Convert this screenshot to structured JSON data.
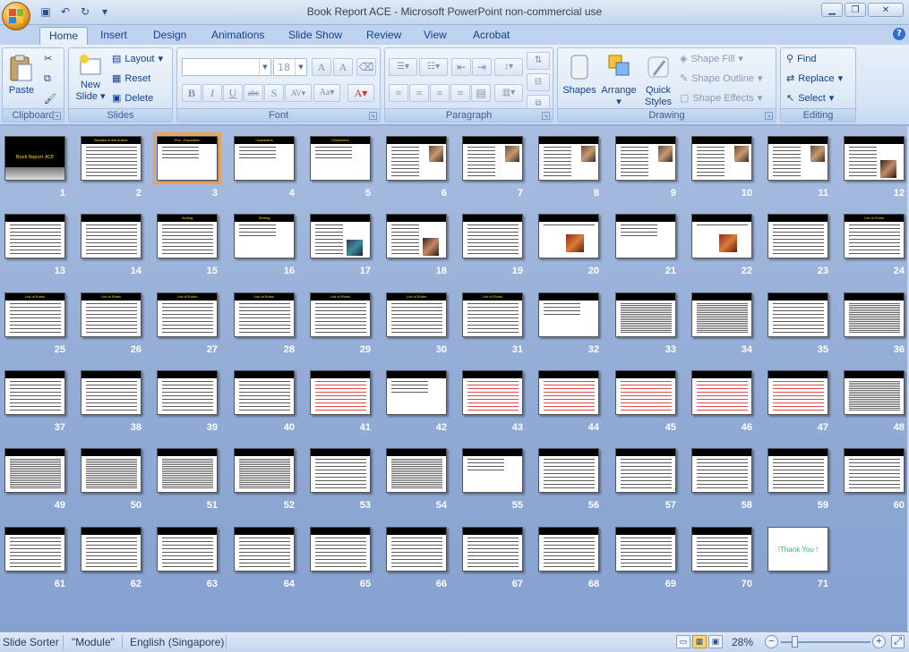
{
  "window": {
    "title": "Book Report ACE - Microsoft PowerPoint non-commercial use"
  },
  "tabs": [
    "Home",
    "Insert",
    "Design",
    "Animations",
    "Slide Show",
    "Review",
    "View",
    "Acrobat"
  ],
  "ribbon": {
    "clipboard": {
      "label": "Clipboard",
      "paste": "Paste"
    },
    "slides": {
      "label": "Slides",
      "new_slide": "New",
      "new_slide_2": "Slide",
      "layout": "Layout",
      "reset": "Reset",
      "delete": "Delete"
    },
    "font": {
      "label": "Font",
      "font_size": "18"
    },
    "paragraph": {
      "label": "Paragraph"
    },
    "drawing": {
      "label": "Drawing",
      "shapes": "Shapes",
      "arrange": "Arrange",
      "quick_styles_1": "Quick",
      "quick_styles_2": "Styles",
      "shape_fill": "Shape Fill",
      "shape_outline": "Shape Outline",
      "shape_effects": "Shape Effects"
    },
    "editing": {
      "label": "Editing",
      "find": "Find",
      "replace": "Replace",
      "select": "Select"
    }
  },
  "slides": [
    {
      "n": "1",
      "title": "Book Report ACE",
      "kind": "cover"
    },
    {
      "n": "2",
      "title": "Biodata of the Author",
      "kind": "text"
    },
    {
      "n": "3",
      "title": "Plot - Exposition",
      "kind": "short",
      "selected": true
    },
    {
      "n": "4",
      "title": "Characters",
      "kind": "short"
    },
    {
      "n": "5",
      "title": "Characters",
      "kind": "short"
    },
    {
      "n": "6",
      "title": "",
      "kind": "photo"
    },
    {
      "n": "7",
      "title": "",
      "kind": "photo"
    },
    {
      "n": "8",
      "title": "",
      "kind": "photo"
    },
    {
      "n": "9",
      "title": "",
      "kind": "photo"
    },
    {
      "n": "10",
      "title": "",
      "kind": "photo"
    },
    {
      "n": "11",
      "title": "",
      "kind": "photo"
    },
    {
      "n": "12",
      "title": "",
      "kind": "face"
    },
    {
      "n": "13",
      "title": "",
      "kind": "text"
    },
    {
      "n": "14",
      "title": "",
      "kind": "text"
    },
    {
      "n": "15",
      "title": "Setting",
      "kind": "text"
    },
    {
      "n": "16",
      "title": "Setting",
      "kind": "short"
    },
    {
      "n": "17",
      "title": "",
      "kind": "lowphoto"
    },
    {
      "n": "18",
      "title": "",
      "kind": "face"
    },
    {
      "n": "19",
      "title": "",
      "kind": "text"
    },
    {
      "n": "20",
      "title": "",
      "kind": "midphoto"
    },
    {
      "n": "21",
      "title": "",
      "kind": "short"
    },
    {
      "n": "22",
      "title": "",
      "kind": "midphoto"
    },
    {
      "n": "23",
      "title": "",
      "kind": "text"
    },
    {
      "n": "24",
      "title": "List of Rules",
      "kind": "text"
    },
    {
      "n": "25",
      "title": "List of Rules",
      "kind": "text"
    },
    {
      "n": "26",
      "title": "List of Rules",
      "kind": "text"
    },
    {
      "n": "27",
      "title": "List of Rules",
      "kind": "text"
    },
    {
      "n": "28",
      "title": "List of Rules",
      "kind": "text"
    },
    {
      "n": "29",
      "title": "List of Rules",
      "kind": "text"
    },
    {
      "n": "30",
      "title": "List of Rules",
      "kind": "text"
    },
    {
      "n": "31",
      "title": "List of Rules",
      "kind": "text"
    },
    {
      "n": "32",
      "title": "",
      "kind": "short"
    },
    {
      "n": "33",
      "title": "",
      "kind": "dense"
    },
    {
      "n": "34",
      "title": "",
      "kind": "dense"
    },
    {
      "n": "35",
      "title": "",
      "kind": "text"
    },
    {
      "n": "36",
      "title": "",
      "kind": "dense"
    },
    {
      "n": "37",
      "title": "",
      "kind": "text"
    },
    {
      "n": "38",
      "title": "",
      "kind": "text"
    },
    {
      "n": "39",
      "title": "",
      "kind": "text"
    },
    {
      "n": "40",
      "title": "",
      "kind": "text"
    },
    {
      "n": "41",
      "title": "",
      "kind": "red"
    },
    {
      "n": "42",
      "title": "",
      "kind": "short"
    },
    {
      "n": "43",
      "title": "",
      "kind": "red"
    },
    {
      "n": "44",
      "title": "",
      "kind": "red"
    },
    {
      "n": "45",
      "title": "",
      "kind": "red"
    },
    {
      "n": "46",
      "title": "",
      "kind": "red"
    },
    {
      "n": "47",
      "title": "",
      "kind": "red"
    },
    {
      "n": "48",
      "title": "",
      "kind": "dense"
    },
    {
      "n": "49",
      "title": "",
      "kind": "dense"
    },
    {
      "n": "50",
      "title": "",
      "kind": "dense"
    },
    {
      "n": "51",
      "title": "",
      "kind": "dense"
    },
    {
      "n": "52",
      "title": "",
      "kind": "dense"
    },
    {
      "n": "53",
      "title": "",
      "kind": "text"
    },
    {
      "n": "54",
      "title": "",
      "kind": "dense"
    },
    {
      "n": "55",
      "title": "",
      "kind": "short"
    },
    {
      "n": "56",
      "title": "",
      "kind": "text"
    },
    {
      "n": "57",
      "title": "",
      "kind": "text"
    },
    {
      "n": "58",
      "title": "",
      "kind": "text"
    },
    {
      "n": "59",
      "title": "",
      "kind": "text"
    },
    {
      "n": "60",
      "title": "",
      "kind": "text"
    },
    {
      "n": "61",
      "title": "",
      "kind": "text"
    },
    {
      "n": "62",
      "title": "",
      "kind": "text"
    },
    {
      "n": "63",
      "title": "",
      "kind": "text"
    },
    {
      "n": "64",
      "title": "",
      "kind": "text"
    },
    {
      "n": "65",
      "title": "",
      "kind": "text"
    },
    {
      "n": "66",
      "title": "",
      "kind": "text"
    },
    {
      "n": "67",
      "title": "",
      "kind": "text"
    },
    {
      "n": "68",
      "title": "",
      "kind": "text"
    },
    {
      "n": "69",
      "title": "",
      "kind": "text"
    },
    {
      "n": "70",
      "title": "",
      "kind": "text"
    },
    {
      "n": "71",
      "title": "",
      "kind": "thanks",
      "text": "!Thank You !"
    }
  ],
  "statusbar": {
    "view": "Slide Sorter",
    "theme": "\"Module\"",
    "language": "English (Singapore)",
    "zoom": "28%"
  }
}
